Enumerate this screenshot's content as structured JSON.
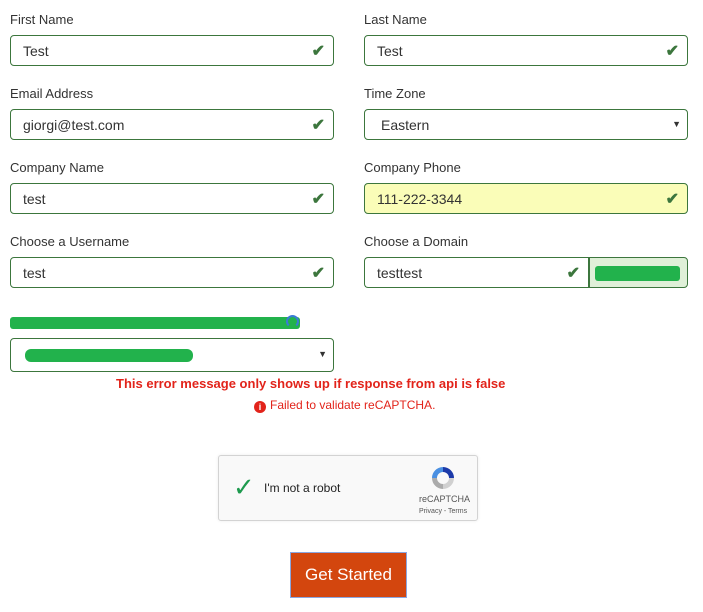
{
  "form": {
    "first_name": {
      "label": "First Name",
      "value": "Test"
    },
    "last_name": {
      "label": "Last Name",
      "value": "Test"
    },
    "email": {
      "label": "Email Address",
      "value": "giorgi@test.com"
    },
    "time_zone": {
      "label": "Time Zone",
      "value": "Eastern"
    },
    "company_name": {
      "label": "Company Name",
      "value": "test"
    },
    "company_phone": {
      "label": "Company Phone",
      "value": "111-222-3344"
    },
    "username": {
      "label": "Choose a Username",
      "value": "test"
    },
    "domain": {
      "label": "Choose a Domain",
      "value": "testtest"
    }
  },
  "icons": {
    "check": "✔",
    "caret": "▼",
    "info": "i",
    "captcha_tick": "✓"
  },
  "errors": {
    "main": "This error message only shows up if response from api is false",
    "recaptcha": "Failed to validate reCAPTCHA."
  },
  "captcha": {
    "label": "I'm not a robot",
    "brand": "reCAPTCHA",
    "links": "Privacy - Terms"
  },
  "submit": {
    "label": "Get Started"
  },
  "colors": {
    "valid": "#3c763d",
    "error": "#e2231a",
    "button": "#d3460e"
  }
}
